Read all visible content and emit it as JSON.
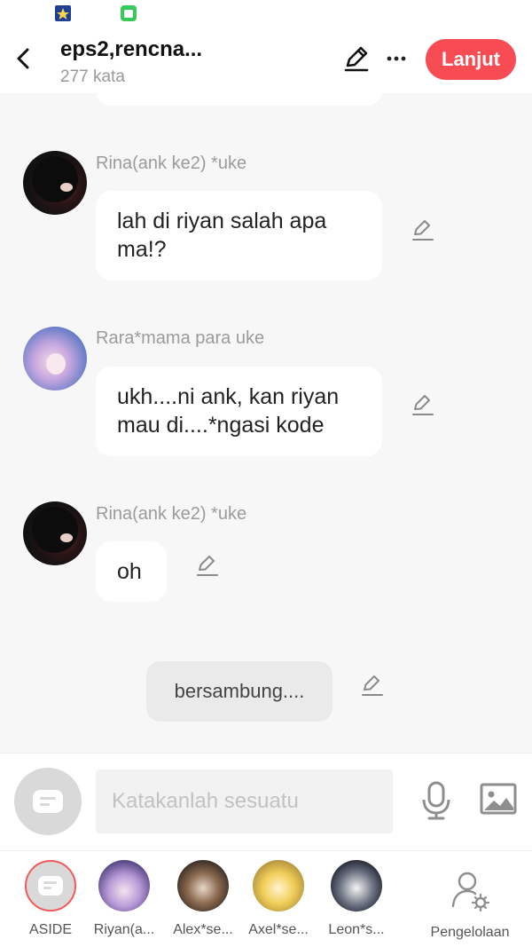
{
  "header": {
    "title": "eps2,rencna...",
    "word_count": "277 kata",
    "next_label": "Lanjut"
  },
  "messages": [
    {
      "sender": "Rina(ank ke2) *uke",
      "text": "lah di riyan salah apa ma!?",
      "avatar": "dark-hair-avatar"
    },
    {
      "sender": "Rara*mama para uke",
      "text": "ukh....ni ank, kan riyan mau di....*ngasi kode",
      "avatar": "purple-hair-avatar"
    },
    {
      "sender": "Rina(ank ke2) *uke",
      "text": "oh",
      "avatar": "dark-hair-avatar"
    }
  ],
  "narration": "bersambung....",
  "input": {
    "placeholder": "Katakanlah sesuatu"
  },
  "cast": [
    {
      "label": "ASIDE"
    },
    {
      "label": "Riyan(a..."
    },
    {
      "label": "Alex*se..."
    },
    {
      "label": "Axel*se..."
    },
    {
      "label": "Leon*s..."
    }
  ],
  "manage_label": "Pengelolaan",
  "colors": {
    "accent": "#f84c55",
    "background": "#f7f7f7",
    "sender": "#9b9b9b"
  },
  "icons": [
    "back-arrow-icon",
    "pencil-icon",
    "more-icon",
    "mic-icon",
    "image-icon",
    "manage-user-icon"
  ]
}
